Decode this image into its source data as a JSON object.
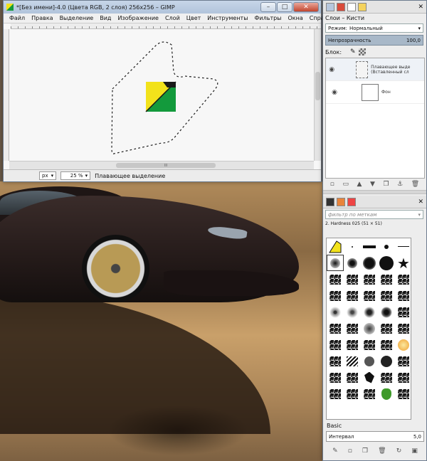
{
  "image_window": {
    "title": "*[Без имени]-4.0 (Цвета RGB, 2 слоя) 256x256 – GIMP",
    "minimize": "–",
    "maximize": "□",
    "close": "✕",
    "menu": [
      "Файл",
      "Правка",
      "Выделение",
      "Вид",
      "Изображение",
      "Слой",
      "Цвет",
      "Инструменты",
      "Фильтры",
      "Окна",
      "Справка"
    ],
    "status": {
      "unit": "px",
      "zoom": "25 %",
      "message": "Плавающее выделение"
    },
    "hscroll_mark": "III"
  },
  "dock": {
    "title": "Слои – Кисти",
    "close": "✕",
    "mode_label": "Режим:",
    "mode_value": "Нормальный",
    "opacity_label": "Непрозрачность",
    "opacity_value": "100,0",
    "lock_label": "Блок:",
    "layers": [
      {
        "name": "Плавающее выде (Вставленный сл"
      },
      {
        "name": "Фон"
      }
    ],
    "brush_filter_placeholder": "фильтр по меткам",
    "brush_name": "2. Hardness 025 (51 × 51)",
    "brush_preset": "Basic",
    "spacing_label": "Интервал",
    "spacing_value": "5,0"
  },
  "colors": {
    "yellow": "#f2e21b",
    "green": "#139a3c",
    "black": "#1a1a1a"
  }
}
